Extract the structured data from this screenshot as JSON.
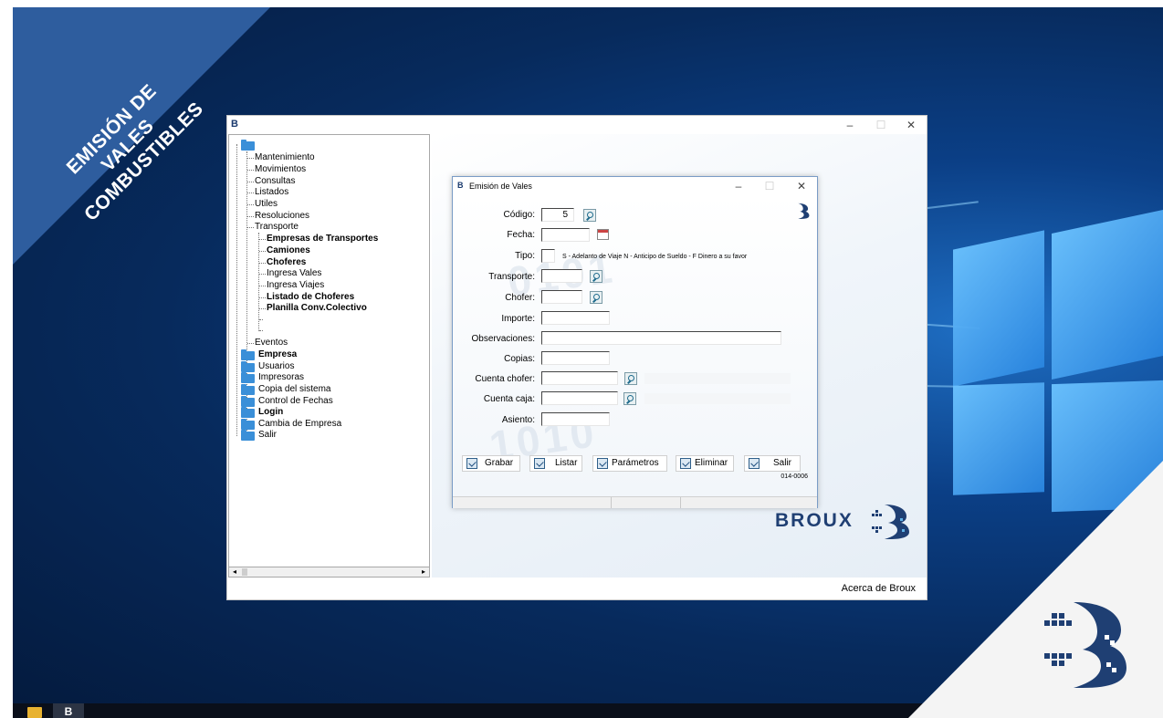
{
  "banner": {
    "line1": "EMISIÓN DE",
    "line2": "VALES COMBUSTIBLES"
  },
  "main_window": {
    "controls": {
      "minimize": "–",
      "maximize": "☐",
      "close": "✕"
    },
    "footer_link": "Acerca de Broux",
    "logo_text": "BROUX"
  },
  "tree": {
    "top_children": [
      "Mantenimiento",
      "Movimientos",
      "Consultas",
      "Listados",
      "Utiles",
      "Resoluciones",
      "Transporte"
    ],
    "transporte_children": [
      "Empresas de Transportes",
      "Camiones",
      "Choferes",
      "Ingresa Vales",
      "Ingresa Viajes",
      "Listado de Choferes",
      "Planilla Conv.Colectivo"
    ],
    "eventos": "Eventos",
    "root_folders": [
      "Empresa",
      "Usuarios",
      "Impresoras",
      "Copia del sistema",
      "Control de Fechas",
      "Login",
      "Cambia de Empresa",
      "Salir"
    ]
  },
  "dialog": {
    "title": "Emisión de Vales",
    "controls": {
      "minimize": "–",
      "maximize": "☐",
      "close": "✕"
    },
    "labels": {
      "codigo": "Código:",
      "fecha": "Fecha:",
      "tipo": "Tipo:",
      "transporte": "Transporte:",
      "chofer": "Chofer:",
      "importe": "Importe:",
      "observaciones": "Observaciones:",
      "copias": "Copias:",
      "cuenta_chofer": "Cuenta chofer:",
      "cuenta_caja": "Cuenta caja:",
      "asiento": "Asiento:"
    },
    "values": {
      "codigo": "5"
    },
    "tipo_help": "S - Adelanto de Viaje  N - Anticipo de Sueldo - F Dinero a su favor",
    "buttons": {
      "grabar": "Grabar",
      "listar": "Listar",
      "parametros": "Parámetros",
      "eliminar": "Eliminar",
      "salir": "Salir"
    },
    "form_code": "014-0006"
  },
  "taskbar": {
    "app_label": "B"
  },
  "colors": {
    "banner": "#2e5d9e",
    "desktop": "#0b3f86",
    "brand": "#1f3f73",
    "folder": "#3a8fd8"
  }
}
